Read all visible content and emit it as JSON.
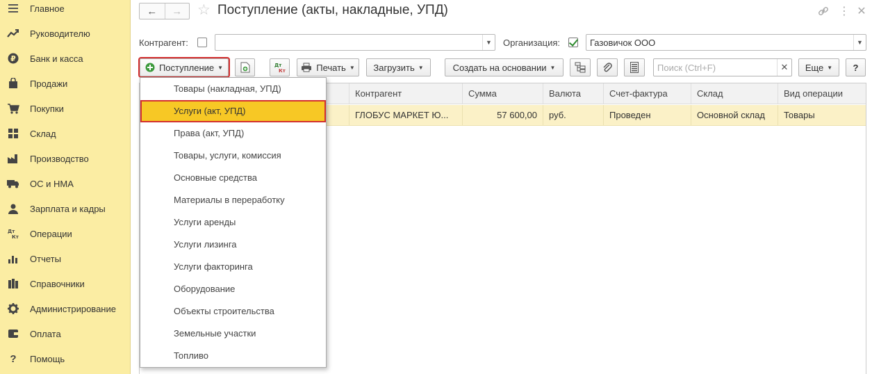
{
  "sidebar": {
    "items": [
      {
        "label": "Главное",
        "icon": "menu-icon"
      },
      {
        "label": "Руководителю",
        "icon": "trend-icon"
      },
      {
        "label": "Банк и касса",
        "icon": "ruble-icon"
      },
      {
        "label": "Продажи",
        "icon": "shopping-bag-icon"
      },
      {
        "label": "Покупки",
        "icon": "cart-icon"
      },
      {
        "label": "Склад",
        "icon": "warehouse-icon"
      },
      {
        "label": "Производство",
        "icon": "factory-icon"
      },
      {
        "label": "ОС и НМА",
        "icon": "truck-icon"
      },
      {
        "label": "Зарплата и кадры",
        "icon": "person-icon"
      },
      {
        "label": "Операции",
        "icon": "dt-kt-icon"
      },
      {
        "label": "Отчеты",
        "icon": "bar-chart-icon"
      },
      {
        "label": "Справочники",
        "icon": "books-icon"
      },
      {
        "label": "Администрирование",
        "icon": "gear-icon"
      },
      {
        "label": "Оплата",
        "icon": "wallet-icon"
      },
      {
        "label": "Помощь",
        "icon": "question-icon"
      }
    ]
  },
  "header": {
    "title": "Поступление (акты, накладные, УПД)"
  },
  "filters": {
    "contractor_label": "Контрагент:",
    "contractor_value": "",
    "org_label": "Организация:",
    "org_value": "Газовичок ООО"
  },
  "toolbar": {
    "receipt_label": "Поступление",
    "print_label": "Печать",
    "load_label": "Загрузить",
    "create_based_label": "Создать на основании",
    "search_placeholder": "Поиск (Ctrl+F)",
    "more_label": "Еще",
    "help_label": "?",
    "dtkt_top": "Дт",
    "dtkt_bottom": "Кт"
  },
  "table": {
    "columns": [
      "Контрагент",
      "Сумма",
      "Валюта",
      "Счет-фактура",
      "Склад",
      "Вид операции"
    ],
    "rows": [
      [
        "ГЛОБУС МАРКЕТ Ю...",
        "57 600,00",
        "руб.",
        "Проведен",
        "Основной склад",
        "Товары"
      ]
    ]
  },
  "menu": {
    "items": [
      "Товары (накладная, УПД)",
      "Услуги (акт, УПД)",
      "Права (акт, УПД)",
      "Товары, услуги, комиссия",
      "Основные средства",
      "Материалы в переработку",
      "Услуги аренды",
      "Услуги лизинга",
      "Услуги факторинга",
      "Оборудование",
      "Объекты строительства",
      "Земельные участки",
      "Топливо"
    ],
    "active_index": 1
  }
}
